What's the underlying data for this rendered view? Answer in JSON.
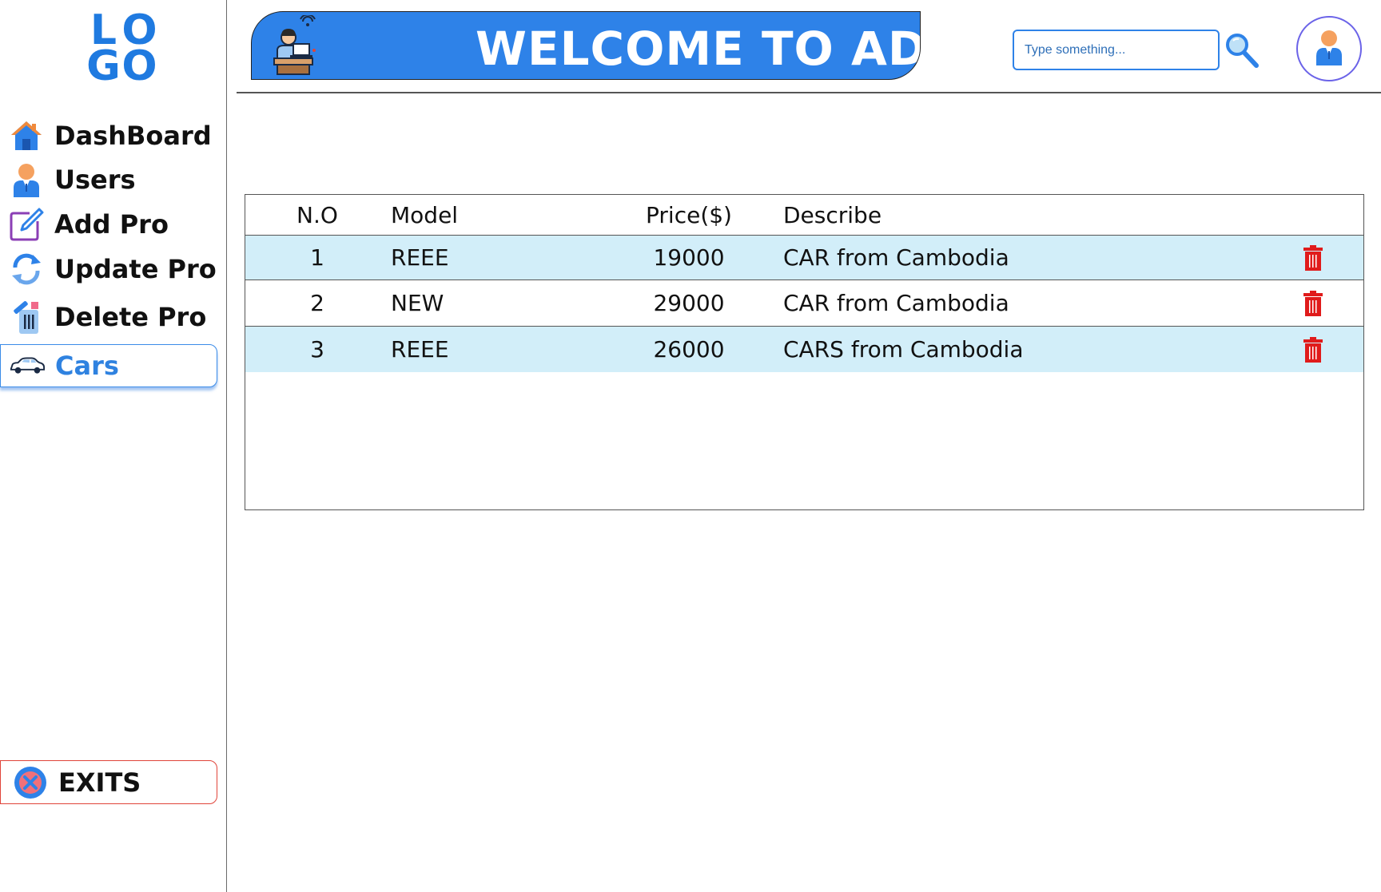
{
  "logo": {
    "line1": [
      "L",
      "O"
    ],
    "line2": [
      "G",
      "O"
    ]
  },
  "sidebar": {
    "items": [
      {
        "label": "DashBoard",
        "icon": "house-icon"
      },
      {
        "label": "Users",
        "icon": "user-icon"
      },
      {
        "label": "Add Pro",
        "icon": "edit-icon"
      },
      {
        "label": "Update Pro",
        "icon": "refresh-icon"
      },
      {
        "label": "Delete Pro",
        "icon": "trash-icon"
      },
      {
        "label": "Cars",
        "icon": "car-icon",
        "active": true
      }
    ],
    "exit": {
      "label": "EXITS",
      "icon": "close-circle-icon"
    }
  },
  "header": {
    "banner_title": "WELCOME TO ADMIN",
    "search_placeholder": "Type something..."
  },
  "table": {
    "columns": [
      "N.O",
      "Model",
      "Price($)",
      "Describe"
    ],
    "rows": [
      {
        "no": "1",
        "model": "REEE",
        "price": "19000",
        "describe": "CAR from Cambodia"
      },
      {
        "no": "2",
        "model": "NEW",
        "price": "29000",
        "describe": "CAR from Cambodia"
      },
      {
        "no": "3",
        "model": "REEE",
        "price": "26000",
        "describe": "CARS from Cambodia"
      }
    ]
  },
  "colors": {
    "accent": "#2e82e8",
    "row_highlight": "#d2eef9",
    "delete": "#e01b1b",
    "exit_border": "#e0443a",
    "profile_ring": "#6b63e8"
  }
}
